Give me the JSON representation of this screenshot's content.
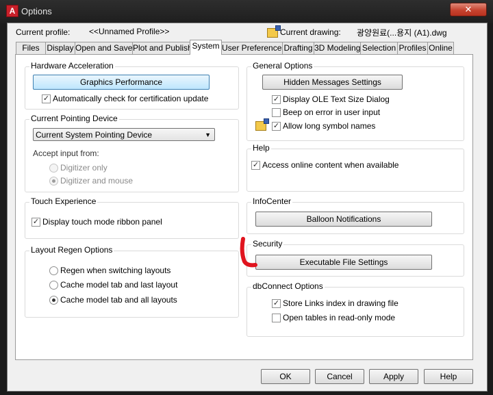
{
  "window": {
    "title": "Options",
    "app_icon": "A",
    "close_glyph": "✕"
  },
  "header": {
    "current_profile_label": "Current profile:",
    "current_profile_value": "<<Unnamed Profile>>",
    "current_drawing_label": "Current drawing:",
    "current_drawing_value": "광양원료(...용지 (A1).dwg"
  },
  "tabs": [
    {
      "label": "Files",
      "active": false
    },
    {
      "label": "Display",
      "active": false
    },
    {
      "label": "Open and Save",
      "active": false
    },
    {
      "label": "Plot and Publish",
      "active": false
    },
    {
      "label": "System",
      "active": true
    },
    {
      "label": "User Preferences",
      "active": false
    },
    {
      "label": "Drafting",
      "active": false
    },
    {
      "label": "3D Modeling",
      "active": false
    },
    {
      "label": "Selection",
      "active": false
    },
    {
      "label": "Profiles",
      "active": false
    },
    {
      "label": "Online",
      "active": false
    }
  ],
  "hardware_acceleration": {
    "title": "Hardware Acceleration",
    "graphics_performance_button": "Graphics Performance",
    "auto_check_label": "Automatically check for certification update",
    "auto_check_checked": true
  },
  "pointing_device": {
    "title": "Current Pointing Device",
    "selected": "Current System Pointing Device",
    "accept_input_label": "Accept input from:",
    "option_digitizer_only": "Digitizer only",
    "option_digitizer_and_mouse": "Digitizer and mouse",
    "selected_option": "Digitizer and mouse"
  },
  "touch_experience": {
    "title": "Touch Experience",
    "ribbon_panel_label": "Display touch mode ribbon panel",
    "ribbon_panel_checked": true
  },
  "layout_regen": {
    "title": "Layout Regen Options",
    "option_regen_switching": "Regen when switching layouts",
    "option_cache_last": "Cache model tab and last layout",
    "option_cache_all": "Cache model tab and all layouts",
    "selected_option": "Cache model tab and all layouts"
  },
  "general_options": {
    "title": "General Options",
    "hidden_messages_button": "Hidden Messages Settings",
    "ole_text_label": "Display OLE Text Size Dialog",
    "ole_text_checked": true,
    "beep_label": "Beep on error in user input",
    "beep_checked": false,
    "long_symbol_label": "Allow long symbol names",
    "long_symbol_checked": true
  },
  "help": {
    "title": "Help",
    "online_content_label": "Access online content when available",
    "online_content_checked": true
  },
  "infocenter": {
    "title": "InfoCenter",
    "balloon_button": "Balloon Notifications"
  },
  "security": {
    "title": "Security",
    "executable_button": "Executable File Settings",
    "annotation_color": "#e0141e"
  },
  "dbconnect": {
    "title": "dbConnect Options",
    "store_links_label": "Store Links index in drawing file",
    "store_links_checked": true,
    "read_only_label": "Open tables in read-only mode",
    "read_only_checked": false
  },
  "footer": {
    "ok": "OK",
    "cancel": "Cancel",
    "apply": "Apply",
    "help": "Help"
  }
}
